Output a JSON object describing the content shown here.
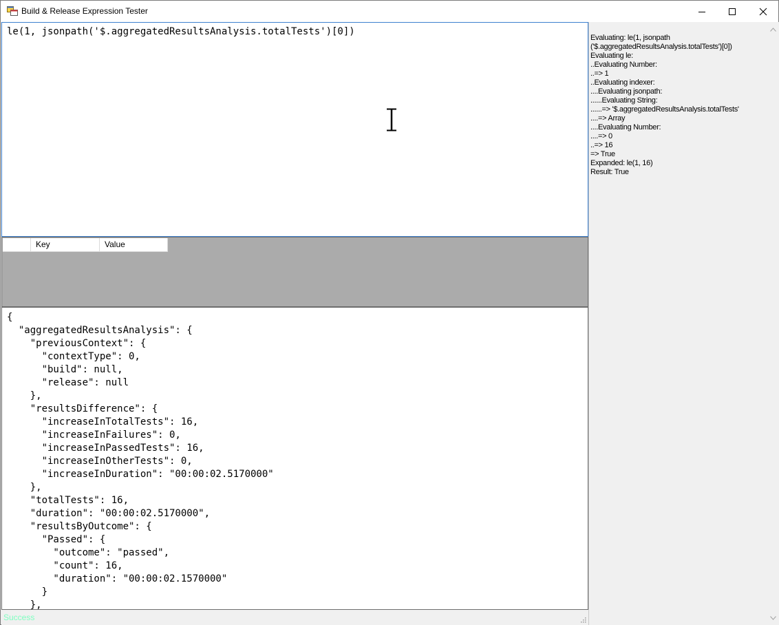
{
  "window": {
    "title": "Build & Release Expression Tester"
  },
  "icons": {
    "app": "app-window-icon",
    "minimize": "minimize-icon",
    "maximize": "maximize-icon",
    "close": "close-icon",
    "cursor": "ibeam-cursor-icon"
  },
  "expression": {
    "text": "le(1, jsonpath('$.aggregatedResultsAnalysis.totalTests')[0])"
  },
  "variables_grid": {
    "columns": [
      "Key",
      "Value"
    ]
  },
  "json_editor": {
    "lines": [
      "{",
      "  \"aggregatedResultsAnalysis\": {",
      "    \"previousContext\": {",
      "      \"contextType\": 0,",
      "      \"build\": null,",
      "      \"release\": null",
      "    },",
      "    \"resultsDifference\": {",
      "      \"increaseInTotalTests\": 16,",
      "      \"increaseInFailures\": 0,",
      "      \"increaseInPassedTests\": 16,",
      "      \"increaseInOtherTests\": 0,",
      "      \"increaseInDuration\": \"00:00:02.5170000\"",
      "    },",
      "    \"totalTests\": 16,",
      "    \"duration\": \"00:00:02.5170000\",",
      "    \"resultsByOutcome\": {",
      "      \"Passed\": {",
      "        \"outcome\": \"passed\",",
      "        \"count\": 16,",
      "        \"duration\": \"00:00:02.1570000\"",
      "      }",
      "    },"
    ]
  },
  "trace": {
    "lines": [
      "Evaluating: le(1, jsonpath",
      "('$.aggregatedResultsAnalysis.totalTests')[0])",
      "Evaluating le:",
      "..Evaluating Number:",
      "..=> 1",
      "..Evaluating indexer:",
      "....Evaluating jsonpath:",
      "......Evaluating String:",
      "......=> '$.aggregatedResultsAnalysis.totalTests'",
      "....=> Array",
      "....Evaluating Number:",
      "....=> 0",
      "..=> 16",
      "=> True",
      "Expanded: le(1, 16)",
      "Result: True"
    ]
  },
  "status": {
    "text": "Success",
    "color": "#7fffc0"
  },
  "colors": {
    "focus_border": "#3b7fcf",
    "grid_background": "#ababab"
  }
}
